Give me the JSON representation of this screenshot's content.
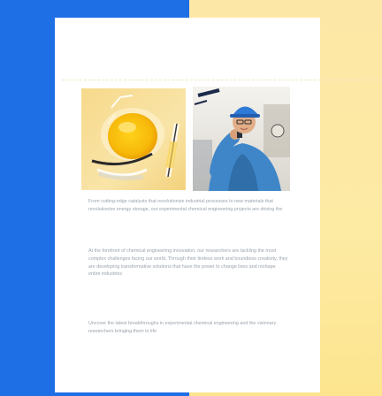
{
  "page": {
    "colors": {
      "left_panel": "#1e6ee6",
      "right_panel": "#fde9a0",
      "card": "#ffffff",
      "body_text": "#9aa3ad"
    }
  },
  "images": {
    "left": {
      "icon": "orange-juice-glass-photo"
    },
    "right": {
      "icon": "engineer-in-lab-photo"
    }
  },
  "article": {
    "paragraph_1": "From cutting-edge catalysts that revolutionize industrial processes to new materials that revolutionize energy storage, our experimental chemical engineering projects are driving the",
    "paragraph_2": "At the forefront of chemical engineering innovation, our researchers are tackling the most complex challenges facing our world. Through their tireless work and boundless creativity, they are developing transformative solutions that have the power to change lives and reshape entire industries",
    "paragraph_3": "Uncover the latest breakthroughs in experimental chemical engineering and the visionary researchers bringing them to life"
  }
}
